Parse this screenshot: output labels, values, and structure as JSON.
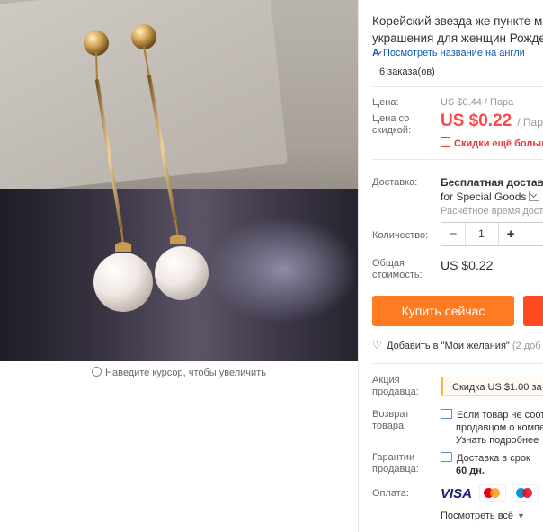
{
  "gallery": {
    "zoom_hint": "Наведите курсор, чтобы увеличить"
  },
  "product": {
    "title_line1": "Корейский звезда же пункте м",
    "title_line2": "украшения для женщин Рожде",
    "translate_link": "Посмотреть название на англи",
    "translate_icon_text": "A̷",
    "orders": "6 заказа(ов)"
  },
  "price": {
    "label_price": "Цена:",
    "old_price": "US $0.44 / Пара",
    "label_discount_line1": "Цена со",
    "label_discount_line2": "скидкой:",
    "new_price": "US $0.22",
    "unit": "/ Пар",
    "discount_note": "Скидки ещё больш"
  },
  "shipping": {
    "label": "Доставка:",
    "value_line1": "Бесплатная доставка",
    "value_line2": "for Special Goods",
    "estimated": "Расчётное время доста"
  },
  "quantity": {
    "label": "Количество:",
    "minus": "−",
    "value": "1",
    "plus": "+"
  },
  "total": {
    "label_line1": "Общая",
    "label_line2": "стоимость:",
    "value": "US $0.22"
  },
  "actions": {
    "buy_now": "Купить сейчас",
    "wishlist": "Добавить в \"Мои желания\"",
    "wishlist_count": "(2 доб"
  },
  "seller": {
    "promo_label_line1": "Акция",
    "promo_label_line2": "продавца:",
    "promo_value": "Скидка US $1.00 за к",
    "return_label_line1": "Возврат",
    "return_label_line2": "товара",
    "return_line1": "Если товар не соот",
    "return_line2": "продавцом о компе",
    "return_line3": "Узнать подробнее",
    "guarantee_label_line1": "Гарантии",
    "guarantee_label_line2": "продавца:",
    "guarantee_line1": "Доставка в срок",
    "guarantee_line2": "60 дн.",
    "payment_label": "Оплата:",
    "visa": "VISA",
    "see_all": "Посмотреть всё"
  }
}
